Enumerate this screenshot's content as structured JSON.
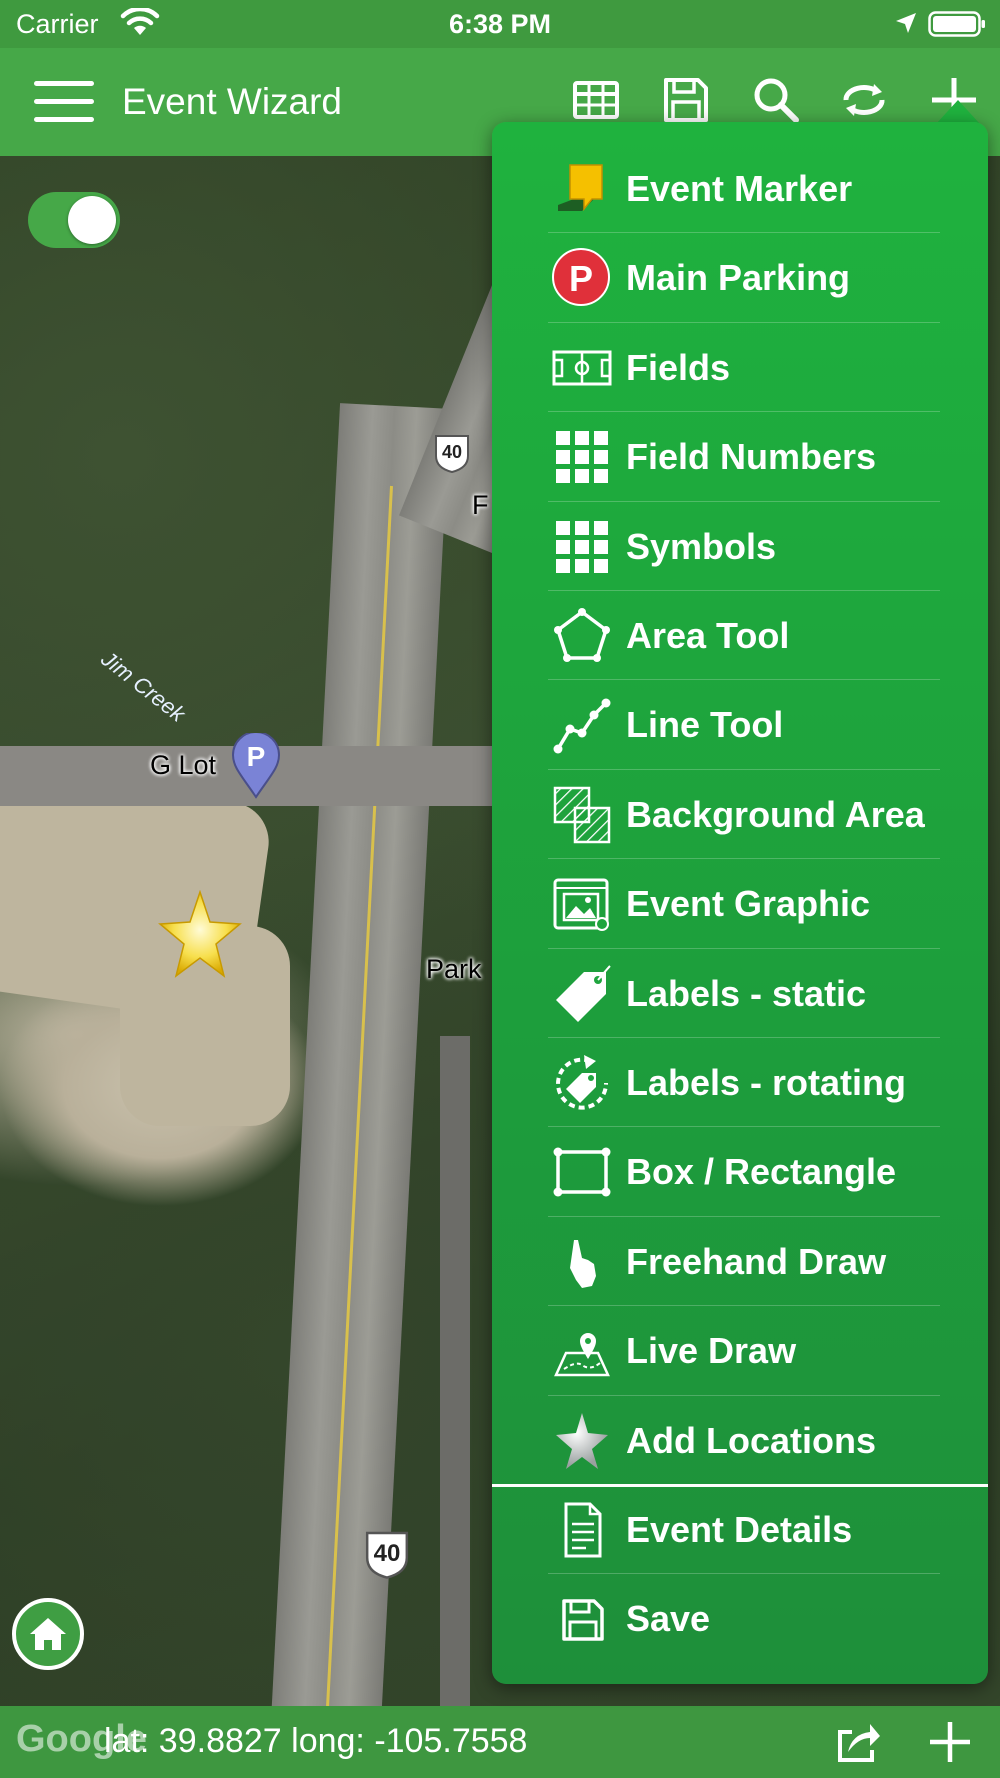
{
  "status_bar": {
    "carrier": "Carrier",
    "time": "6:38 PM"
  },
  "nav": {
    "title": "Event Wizard",
    "icons": [
      "table-icon",
      "save-icon",
      "search-icon",
      "refresh-icon",
      "add-icon"
    ]
  },
  "map": {
    "toggle_on": true,
    "parking_pin_label": "G Lot",
    "parking_pin_letter": "P",
    "creek_label": "Jim Creek",
    "road_label": "Park",
    "road_label_partial": "F",
    "highway_number": "40"
  },
  "bottom_bar": {
    "coords": "lat: 39.8827 long: -105.7558",
    "watermark": "Google"
  },
  "menu": {
    "items": [
      {
        "label": "Event Marker",
        "icon": "event-marker-icon"
      },
      {
        "label": "Main Parking",
        "icon": "parking-icon",
        "letter": "P"
      },
      {
        "label": "Fields",
        "icon": "field-icon"
      },
      {
        "label": "Field Numbers",
        "icon": "grid-icon"
      },
      {
        "label": "Symbols",
        "icon": "grid-icon"
      },
      {
        "label": "Area Tool",
        "icon": "pentagon-icon"
      },
      {
        "label": "Line Tool",
        "icon": "polyline-icon"
      },
      {
        "label": "Background Area",
        "icon": "hatched-squares-icon"
      },
      {
        "label": "Event Graphic",
        "icon": "image-frame-icon"
      },
      {
        "label": "Labels - static",
        "icon": "tag-icon"
      },
      {
        "label": "Labels - rotating",
        "icon": "rotating-tag-icon"
      },
      {
        "label": "Box / Rectangle",
        "icon": "rectangle-icon"
      },
      {
        "label": "Freehand Draw",
        "icon": "hand-pointer-icon"
      },
      {
        "label": "Live Draw",
        "icon": "map-pin-path-icon"
      },
      {
        "label": "Add Locations",
        "icon": "star-icon"
      }
    ],
    "footer_items": [
      {
        "label": "Event Details",
        "icon": "document-icon"
      },
      {
        "label": "Save",
        "icon": "save-icon"
      }
    ]
  },
  "colors": {
    "header": "#46a848",
    "menu": "#1fb23e",
    "parking_red": "#e0303a",
    "pin_blue": "#7a83d6",
    "marker_yellow": "#f5c000"
  }
}
